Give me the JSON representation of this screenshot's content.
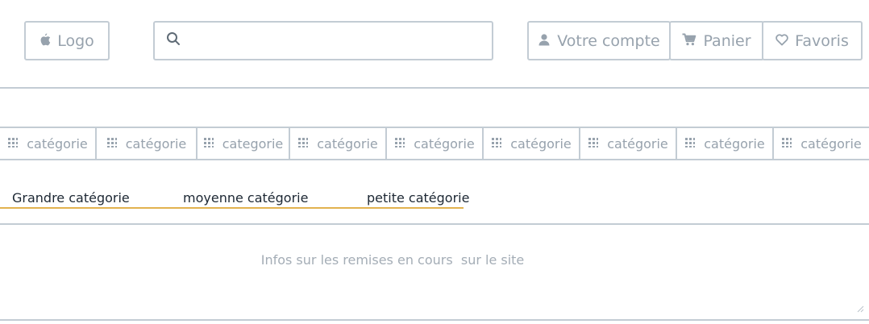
{
  "header": {
    "logo_label": "Logo",
    "search": {
      "value": "",
      "placeholder": ""
    },
    "account_label": "Votre compte",
    "cart_label": "Panier",
    "favorites_label": "Favoris"
  },
  "categories": [
    "catégorie",
    "catégorie",
    "categorie",
    "catégorie",
    "catégorie",
    "catégorie",
    "catégorie",
    "catégorie",
    "catégorie"
  ],
  "breadcrumb": {
    "large": "Grandre catégorie",
    "medium": "moyenne catégorie",
    "small": "petite catégorie"
  },
  "promo": {
    "text": "Infos sur les remises en cours  sur le site"
  },
  "colors": {
    "border": "#c3ccd4",
    "muted_text": "#97a2ad",
    "dark_text": "#1c2733",
    "accent_underline": "#e2b24f"
  },
  "icons": {
    "logo": "apple-icon",
    "search": "search-icon",
    "account": "user-icon",
    "cart": "cart-icon",
    "favorites": "heart-icon",
    "category": "grid-icon"
  }
}
